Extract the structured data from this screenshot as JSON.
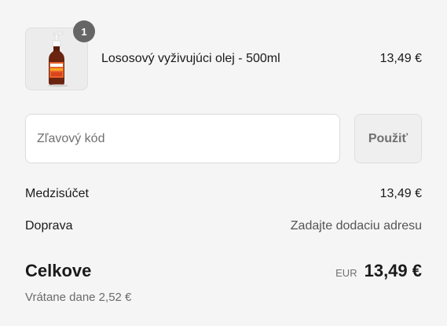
{
  "cart": {
    "items": [
      {
        "name": "Lososový vyživujúci olej - 500ml",
        "price": "13,49 €",
        "quantity": "1",
        "image_icon": "product-bottle-icon"
      }
    ]
  },
  "discount": {
    "placeholder": "Zľavový kód",
    "value": "",
    "apply_label": "Použiť"
  },
  "summary": {
    "subtotal_label": "Medzisúčet",
    "subtotal_value": "13,49 €",
    "shipping_label": "Doprava",
    "shipping_value": "Zadajte dodaciu adresu",
    "total_label": "Celkove",
    "currency_code": "EUR",
    "total_value": "13,49 €",
    "tax_note": "Vrátane dane 2,52 €"
  },
  "colors": {
    "background": "#f4f5f4",
    "badge": "#666666",
    "text": "#1a1a1a",
    "muted": "#707070"
  }
}
